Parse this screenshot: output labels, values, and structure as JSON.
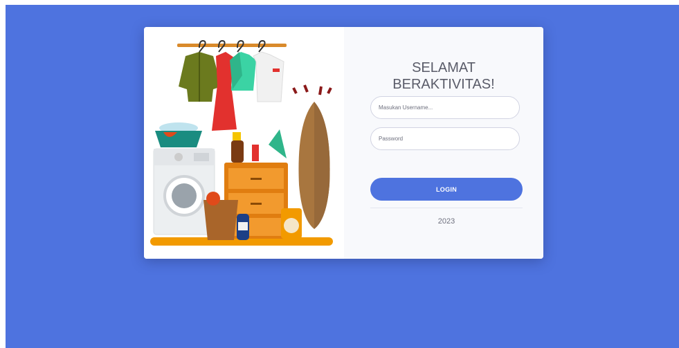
{
  "login": {
    "title_line1": "SELAMAT",
    "title_line2": "BERAKTIVITAS!",
    "username_placeholder": "Masukan Username...",
    "password_placeholder": "Password",
    "login_label": "LOGIN",
    "footer_year": "2023"
  },
  "colors": {
    "background": "#4e73df",
    "button": "#4e73df",
    "panel": "#f8f9fc",
    "title_text": "#5a5c69"
  },
  "illustration": {
    "subject": "laundry room"
  }
}
